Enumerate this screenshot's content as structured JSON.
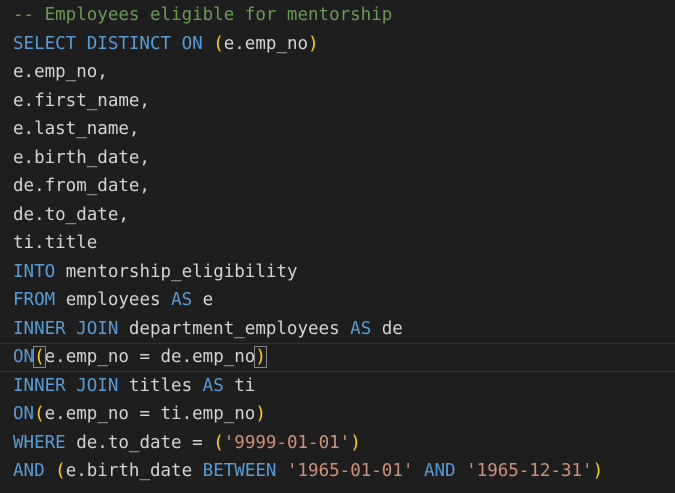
{
  "editor": {
    "language": "sql",
    "colors": {
      "background": "#1e1e1e",
      "comment": "#6a9955",
      "keyword": "#569cd6",
      "identifier": "#d4d4d4",
      "paren": "#ffd700",
      "string": "#ce9178"
    },
    "current_line_index": 12,
    "lines": [
      [
        {
          "t": "-- Employees eligible for mentorship",
          "k": "comment"
        }
      ],
      [
        {
          "t": "SELECT DISTINCT ON ",
          "k": "keyword"
        },
        {
          "t": "(",
          "k": "paren"
        },
        {
          "t": "e.emp_no",
          "k": "ident"
        },
        {
          "t": ")",
          "k": "paren"
        }
      ],
      [
        {
          "t": "e.emp_no,",
          "k": "ident"
        }
      ],
      [
        {
          "t": "e.first_name,",
          "k": "ident"
        }
      ],
      [
        {
          "t": "e.last_name,",
          "k": "ident"
        }
      ],
      [
        {
          "t": "e.birth_date,",
          "k": "ident"
        }
      ],
      [
        {
          "t": "de.from_date,",
          "k": "ident"
        }
      ],
      [
        {
          "t": "de.to_date,",
          "k": "ident"
        }
      ],
      [
        {
          "t": "ti.title",
          "k": "ident"
        }
      ],
      [
        {
          "t": "INTO",
          "k": "keyword"
        },
        {
          "t": " mentorship_eligibility",
          "k": "ident"
        }
      ],
      [
        {
          "t": "FROM",
          "k": "keyword"
        },
        {
          "t": " employees ",
          "k": "ident"
        },
        {
          "t": "AS",
          "k": "keyword"
        },
        {
          "t": " e",
          "k": "ident"
        }
      ],
      [
        {
          "t": "INNER JOIN",
          "k": "keyword"
        },
        {
          "t": " department_employees ",
          "k": "ident"
        },
        {
          "t": "AS",
          "k": "keyword"
        },
        {
          "t": " de",
          "k": "ident"
        }
      ],
      [
        {
          "t": "ON",
          "k": "keyword"
        },
        {
          "t": "(",
          "k": "paren",
          "match": true
        },
        {
          "t": "e.emp_no = de.emp_no",
          "k": "ident"
        },
        {
          "t": ")",
          "k": "paren",
          "match": true
        }
      ],
      [
        {
          "t": "INNER JOIN",
          "k": "keyword"
        },
        {
          "t": " titles ",
          "k": "ident"
        },
        {
          "t": "AS",
          "k": "keyword"
        },
        {
          "t": " ti",
          "k": "ident"
        }
      ],
      [
        {
          "t": "ON",
          "k": "keyword"
        },
        {
          "t": "(",
          "k": "paren"
        },
        {
          "t": "e.emp_no = ti.emp_no",
          "k": "ident"
        },
        {
          "t": ")",
          "k": "paren"
        }
      ],
      [
        {
          "t": "WHERE",
          "k": "keyword"
        },
        {
          "t": " de.to_date = ",
          "k": "ident"
        },
        {
          "t": "(",
          "k": "paren"
        },
        {
          "t": "'9999-01-01'",
          "k": "string"
        },
        {
          "t": ")",
          "k": "paren"
        }
      ],
      [
        {
          "t": "AND",
          "k": "keyword"
        },
        {
          "t": " ",
          "k": "ident"
        },
        {
          "t": "(",
          "k": "paren"
        },
        {
          "t": "e.birth_date ",
          "k": "ident"
        },
        {
          "t": "BETWEEN",
          "k": "keyword"
        },
        {
          "t": " ",
          "k": "ident"
        },
        {
          "t": "'1965-01-01'",
          "k": "string"
        },
        {
          "t": " ",
          "k": "ident"
        },
        {
          "t": "AND",
          "k": "keyword"
        },
        {
          "t": " ",
          "k": "ident"
        },
        {
          "t": "'1965-12-31'",
          "k": "string"
        },
        {
          "t": ")",
          "k": "paren"
        }
      ]
    ]
  }
}
